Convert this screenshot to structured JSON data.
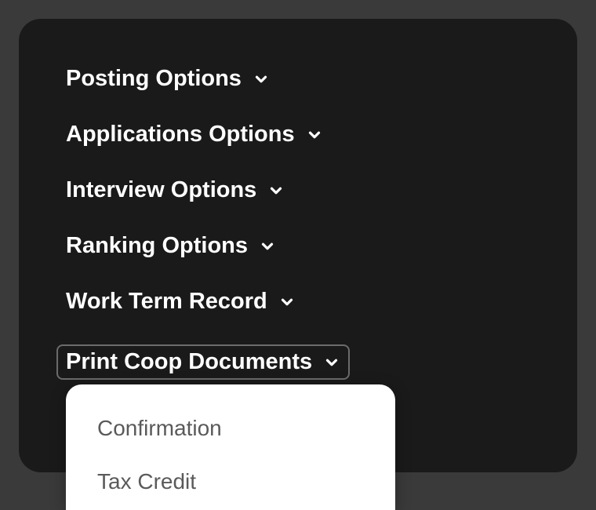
{
  "menu": {
    "items": [
      {
        "label": "Posting Options"
      },
      {
        "label": "Applications Options"
      },
      {
        "label": "Interview Options"
      },
      {
        "label": "Ranking Options"
      },
      {
        "label": "Work Term Record"
      },
      {
        "label": "Print Coop Documents"
      }
    ]
  },
  "dropdown": {
    "items": [
      {
        "label": "Confirmation"
      },
      {
        "label": "Tax Credit"
      }
    ]
  }
}
